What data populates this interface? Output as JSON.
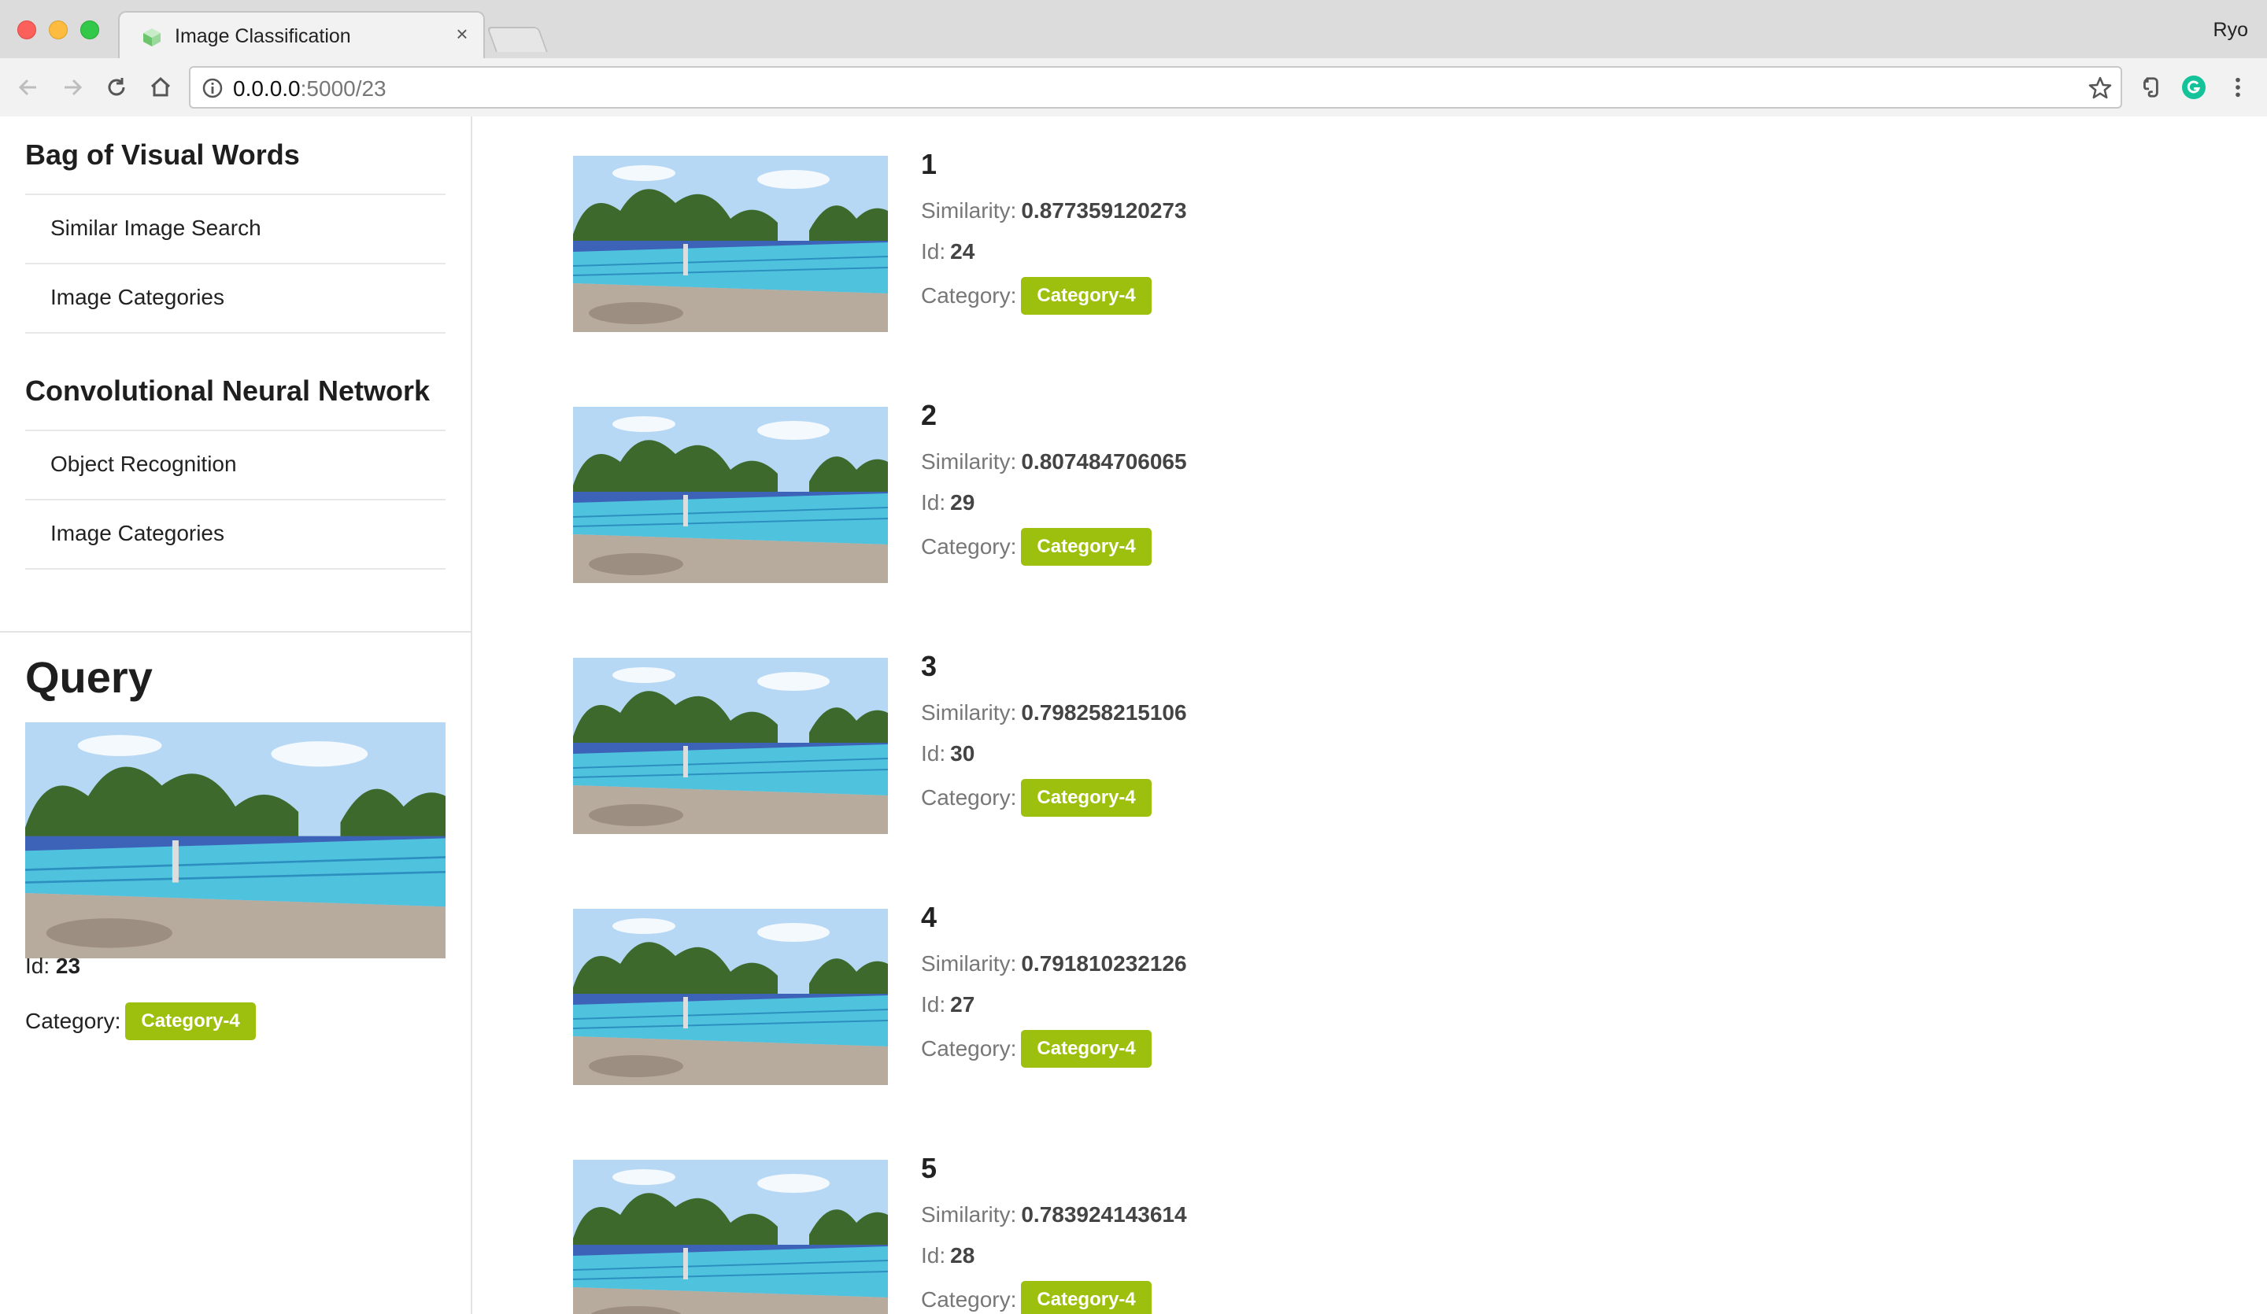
{
  "browser": {
    "tab_title": "Image Classification",
    "close_glyph": "×",
    "profile_name": "Ryo",
    "url_host": "0.0.0.0",
    "url_rest": ":5000/23"
  },
  "sidebar": {
    "sections": [
      {
        "title": "Bag of Visual Words",
        "items": [
          "Similar Image Search",
          "Image Categories"
        ]
      },
      {
        "title": "Convolutional Neural Network",
        "items": [
          "Object Recognition",
          "Image Categories"
        ]
      }
    ]
  },
  "query": {
    "title": "Query",
    "id_label": "Id:",
    "id": "23",
    "category_label": "Category:",
    "category": "Category-4"
  },
  "results": {
    "similarity_label": "Similarity:",
    "id_label": "Id:",
    "category_label": "Category:",
    "items": [
      {
        "rank": "1",
        "similarity": "0.877359120273",
        "id": "24",
        "category": "Category-4"
      },
      {
        "rank": "2",
        "similarity": "0.807484706065",
        "id": "29",
        "category": "Category-4"
      },
      {
        "rank": "3",
        "similarity": "0.798258215106",
        "id": "30",
        "category": "Category-4"
      },
      {
        "rank": "4",
        "similarity": "0.791810232126",
        "id": "27",
        "category": "Category-4"
      },
      {
        "rank": "5",
        "similarity": "0.783924143614",
        "id": "28",
        "category": "Category-4"
      }
    ]
  },
  "colors": {
    "badge": "#9cc00d",
    "pool_water": "#4fc3de",
    "pool_deck": "#b7ab9d",
    "sky": "#b6d8f4",
    "trees": "#3d6a2c"
  }
}
